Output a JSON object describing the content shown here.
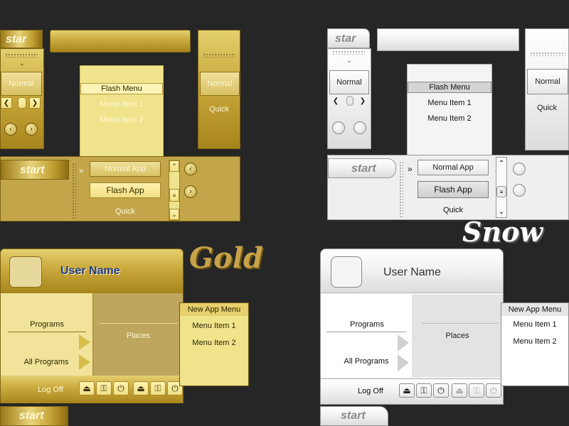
{
  "gold": {
    "theme_label": "Gold",
    "tl_start_label": "star",
    "bar_start_label": "start",
    "bottom_start_label": "start",
    "left_normal_label": "Normal",
    "right_normal_label": "Normal",
    "right_quick_label": "Quick",
    "flash_menu": {
      "title": "Flash Menu",
      "items": [
        "Menu Item 1",
        "Menu Item 2"
      ]
    },
    "taskbar": {
      "arrow": "»",
      "normal_app": "Normal App",
      "flash_app": "Flash App",
      "quick": "Quick"
    },
    "start_menu": {
      "user_name": "User Name",
      "programs": "Programs",
      "all_programs": "All Programs",
      "places": "Places",
      "log_off": "Log Off"
    },
    "app_menu": {
      "title": "New App Menu",
      "items": [
        "Menu Item 1",
        "Menu Item 2"
      ]
    }
  },
  "snow": {
    "theme_label": "Snow",
    "tl_start_label": "star",
    "bar_start_label": "start",
    "bottom_start_label": "start",
    "left_normal_label": "Normal",
    "right_normal_label": "Normal",
    "right_quick_label": "Quick",
    "flash_menu": {
      "title": "Flash Menu",
      "items": [
        "Menu Item 1",
        "Menu Item 2"
      ]
    },
    "taskbar": {
      "arrow": "»",
      "normal_app": "Normal App",
      "flash_app": "Flash App",
      "quick": "Quick"
    },
    "start_menu": {
      "user_name": "User Name",
      "programs": "Programs",
      "all_programs": "All Programs",
      "places": "Places",
      "log_off": "Log Off"
    },
    "app_menu": {
      "title": "New App Menu",
      "items": [
        "Menu Item 1",
        "Menu Item 2"
      ]
    }
  },
  "colors": {
    "background": "#262626",
    "gold_accent": "#c9a93c",
    "snow_accent": "#f1f1f1",
    "user_name_gold": "#1f3c8c"
  },
  "icons": [
    "chevron-down-icon",
    "arrow-left-icon",
    "arrow-right-icon",
    "scroll-up-icon",
    "scroll-down-icon",
    "eject-icon",
    "key-icon",
    "power-icon",
    "play-triangle-icon"
  ]
}
